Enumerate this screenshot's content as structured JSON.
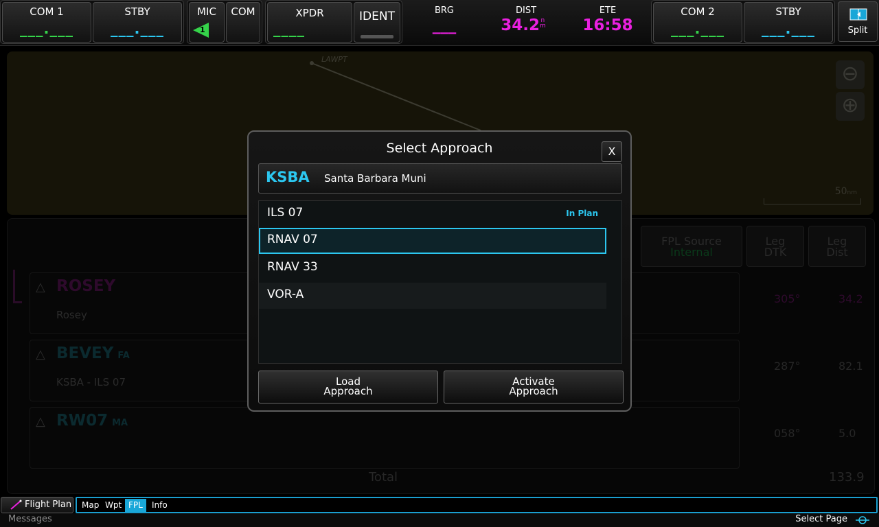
{
  "topbar": {
    "com1": {
      "label": "COM 1",
      "freq": "___.___"
    },
    "com1_stby": {
      "label": "STBY",
      "freq": "___.___"
    },
    "mic": {
      "label": "MIC",
      "number": "1"
    },
    "com_audio": {
      "label": "COM"
    },
    "xpdr": {
      "label": "XPDR",
      "code": "____"
    },
    "ident": {
      "label": "IDENT"
    },
    "brg": {
      "label": "BRG",
      "value": "___"
    },
    "dist": {
      "label": "DIST",
      "value": "34.2",
      "unit_top": "n",
      "unit_bottom": "m"
    },
    "ete": {
      "label": "ETE",
      "value": "16:58"
    },
    "com2": {
      "label": "COM 2",
      "freq": "___.___"
    },
    "com2_stby": {
      "label": "STBY",
      "freq": "___.___"
    },
    "split": {
      "label": "Split"
    }
  },
  "map": {
    "waypoint_label": "LAWPT",
    "scale": "50",
    "scale_unit": "nm"
  },
  "fpl": {
    "headers": [
      {
        "line1": "FPL Source",
        "line2": "Internal"
      },
      {
        "line1": "Leg",
        "line2": "DTK"
      },
      {
        "line1": "Leg",
        "line2": "Dist"
      }
    ],
    "legs": [
      {
        "name": "ROSEY",
        "type": "",
        "sub": "Rosey",
        "dtk": "305°",
        "dist": "34.2"
      },
      {
        "name": "BEVEY",
        "type": "FA",
        "sub": "KSBA - ILS 07",
        "dtk": "287°",
        "dist": "82.1"
      },
      {
        "name": "RW07",
        "type": "MA",
        "sub": "",
        "dtk": "058°",
        "dist": "5.0"
      }
    ],
    "total_label": "Total",
    "total_value": "133.9"
  },
  "modal": {
    "title": "Select Approach",
    "close_label": "X",
    "airport": {
      "ident": "KSBA",
      "name": "Santa Barbara Muni"
    },
    "approaches": [
      {
        "name": "ILS 07",
        "badge": "In Plan"
      },
      {
        "name": "RNAV 07",
        "badge": ""
      },
      {
        "name": "RNAV 33",
        "badge": ""
      },
      {
        "name": "VOR-A",
        "badge": ""
      }
    ],
    "selected_index": 1,
    "load_button": {
      "line1": "Load",
      "line2": "Approach"
    },
    "activate_button": {
      "line1": "Activate",
      "line2": "Approach"
    }
  },
  "bottom": {
    "flight_plan": "Flight Plan",
    "tabs": [
      "Map",
      "Wpt",
      "FPL",
      "Info"
    ],
    "active_tab": "FPL",
    "messages": "Messages",
    "select_page": "Select Page"
  },
  "colors": {
    "cyan": "#2cc7f0",
    "green": "#35d34a",
    "magenta": "#ea20e0",
    "tab_active": "#19a7d8"
  }
}
